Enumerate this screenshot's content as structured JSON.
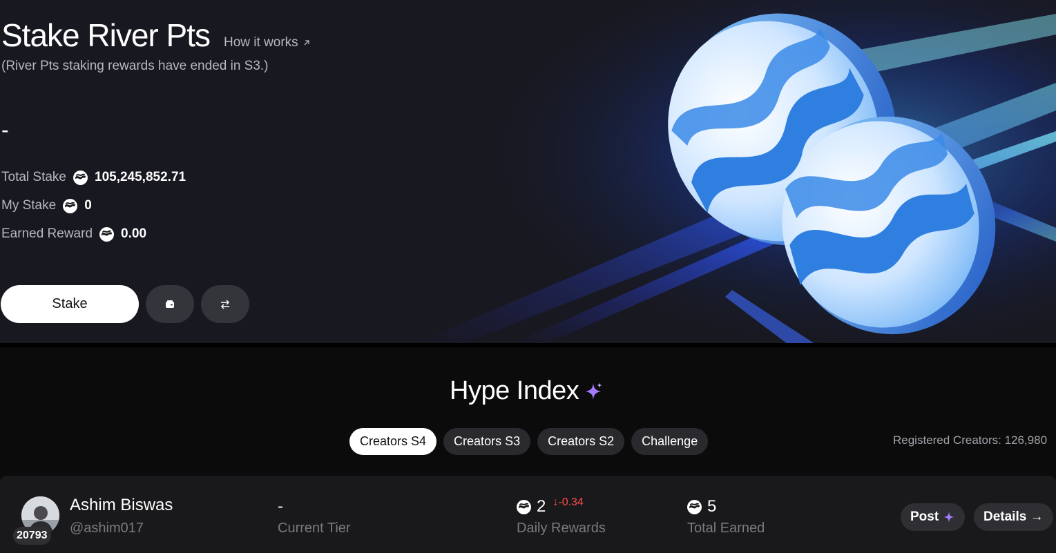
{
  "stake": {
    "title": "Stake River Pts",
    "how_it_works": "How it works",
    "subtitle": "(River Pts staking rewards have ended in S3.)",
    "headline_value": "-",
    "total_stake_label": "Total Stake",
    "total_stake_value": "105,245,852.71",
    "my_stake_label": "My Stake",
    "my_stake_value": "0",
    "earned_reward_label": "Earned Reward",
    "earned_reward_value": "0.00",
    "stake_button": "Stake",
    "icons": [
      "river-pts-icon",
      "wallet-icon",
      "swap-icon",
      "arrow-up-right-icon"
    ]
  },
  "hype": {
    "title": "Hype Index",
    "tabs": [
      {
        "label": "Creators S4",
        "active": true
      },
      {
        "label": "Creators S3",
        "active": false
      },
      {
        "label": "Creators S2",
        "active": false
      },
      {
        "label": "Challenge",
        "active": false
      }
    ],
    "registered_creators": "Registered Creators: 126,980"
  },
  "creator_row": {
    "rank": "20793",
    "name": "Ashim Biswas",
    "handle": "@ashim017",
    "tier_value": "-",
    "tier_label": "Current Tier",
    "daily_rewards_value": "2",
    "daily_rewards_delta": "↓-0.34",
    "daily_rewards_label": "Daily Rewards",
    "total_earned_value": "5",
    "total_earned_label": "Total Earned",
    "post_button": "Post",
    "details_button": "Details →"
  },
  "colors": {
    "hero_bg": "#181820",
    "page_bg": "#0b0b0c",
    "accent_purple": "#a77bff",
    "negative_red": "#ff4d4d",
    "coin_blue": "#2f7fe0"
  }
}
